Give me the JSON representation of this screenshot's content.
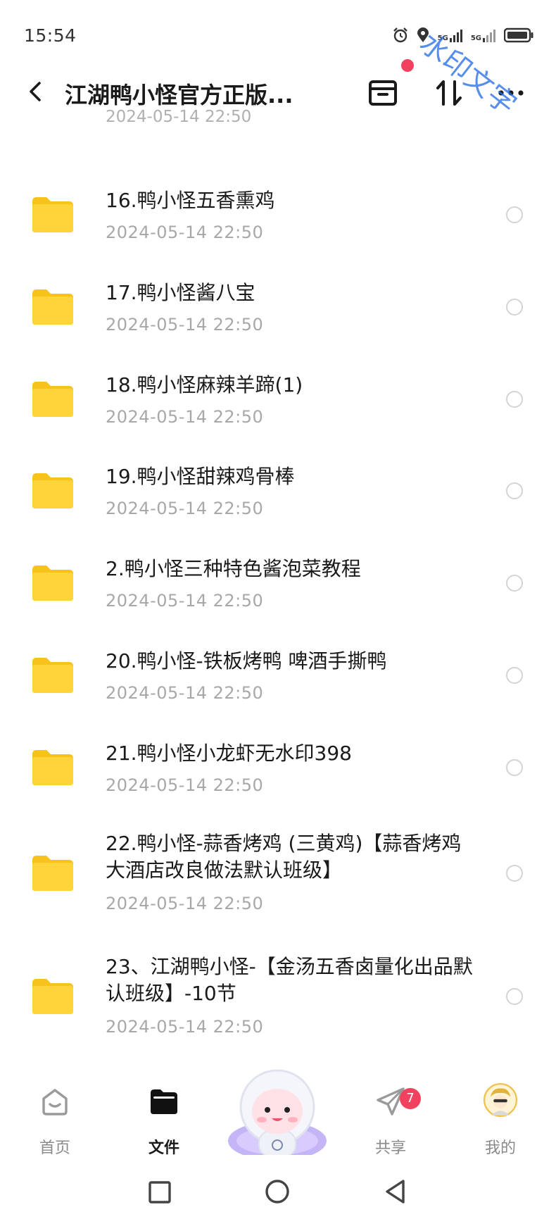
{
  "status_bar": {
    "time": "15:54",
    "network_1": "5G",
    "network_2": "5G"
  },
  "header": {
    "title": "江湖鸭小怪官方正版...",
    "watermark": "水印文字",
    "accent_dot_color": "#f2415e"
  },
  "list": {
    "partial_top_date": "2024-05-14  22:50",
    "items": [
      {
        "name": "16.鸭小怪五香熏鸡",
        "date": "2024-05-14  22:50"
      },
      {
        "name": "17.鸭小怪酱八宝",
        "date": "2024-05-14  22:50"
      },
      {
        "name": "18.鸭小怪麻辣羊蹄(1)",
        "date": "2024-05-14  22:50"
      },
      {
        "name": "19.鸭小怪甜辣鸡骨棒",
        "date": "2024-05-14  22:50"
      },
      {
        "name": "2.鸭小怪三种特色酱泡菜教程",
        "date": "2024-05-14  22:50"
      },
      {
        "name": "20.鸭小怪-铁板烤鸭 啤酒手撕鸭",
        "date": "2024-05-14  22:50"
      },
      {
        "name": "21.鸭小怪小龙虾无水印398",
        "date": "2024-05-14  22:50"
      },
      {
        "name": "22.鸭小怪-蒜香烤鸡 (三黄鸡)【蒜香烤鸡大酒店改良做法默认班级】",
        "date": "2024-05-14  22:50"
      },
      {
        "name": "23、江湖鸭小怪-【金汤五香卤量化出品默认班级】-10节",
        "date": "2024-05-14  22:50"
      }
    ]
  },
  "bottom_nav": {
    "home": "首页",
    "files": "文件",
    "share": "共享",
    "share_badge": "7",
    "me": "我的"
  },
  "colors": {
    "folder": "#ffd43b",
    "badge": "#f2415e",
    "muted_text": "#a8a8a8"
  }
}
